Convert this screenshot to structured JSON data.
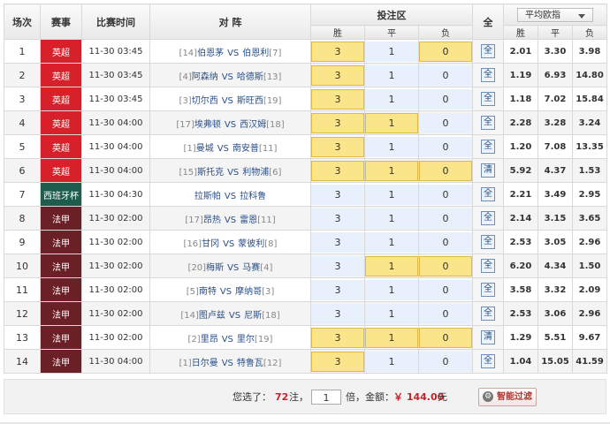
{
  "header": {
    "col_index": "场次",
    "col_league": "赛事",
    "col_time": "比赛时间",
    "col_match": "对 阵",
    "col_bet_zone": "投注区",
    "col_all": "全",
    "odds_dropdown": "平均欧指",
    "sub_win": "胜",
    "sub_draw": "平",
    "sub_loss": "负",
    "odds_win": "胜",
    "odds_draw": "平",
    "odds_loss": "负"
  },
  "colors": {
    "epl": "#d8202b",
    "laliga_cup": "#1e5c4d",
    "ligue1": "#6b1f27",
    "selected": "#fbe58a",
    "unselected": "#e8f1fb"
  },
  "rows": [
    {
      "idx": "1",
      "league": "英超",
      "league_type": "epl",
      "time": "11-30 03:45",
      "home_rank": "[14]",
      "home": "伯恩茅",
      "vs": "VS",
      "away": "伯恩利",
      "away_rank": "[7]",
      "bet_win": "3",
      "bet_draw": "1",
      "bet_loss": "0",
      "sel_win": true,
      "sel_draw": false,
      "sel_loss": true,
      "all_btn": "全",
      "odds_win": "2.01",
      "odds_draw": "3.30",
      "odds_loss": "3.98"
    },
    {
      "idx": "2",
      "league": "英超",
      "league_type": "epl",
      "time": "11-30 03:45",
      "home_rank": "[4]",
      "home": "阿森纳",
      "vs": "VS",
      "away": "哈德斯",
      "away_rank": "[13]",
      "bet_win": "3",
      "bet_draw": "1",
      "bet_loss": "0",
      "sel_win": true,
      "sel_draw": false,
      "sel_loss": false,
      "all_btn": "全",
      "odds_win": "1.19",
      "odds_draw": "6.93",
      "odds_loss": "14.80"
    },
    {
      "idx": "3",
      "league": "英超",
      "league_type": "epl",
      "time": "11-30 03:45",
      "home_rank": "[3]",
      "home": "切尔西",
      "vs": "VS",
      "away": "斯旺西",
      "away_rank": "[19]",
      "bet_win": "3",
      "bet_draw": "1",
      "bet_loss": "0",
      "sel_win": true,
      "sel_draw": false,
      "sel_loss": false,
      "all_btn": "全",
      "odds_win": "1.18",
      "odds_draw": "7.02",
      "odds_loss": "15.84"
    },
    {
      "idx": "4",
      "league": "英超",
      "league_type": "epl",
      "time": "11-30 04:00",
      "home_rank": "[17]",
      "home": "埃弗顿",
      "vs": "VS",
      "away": "西汉姆",
      "away_rank": "[18]",
      "bet_win": "3",
      "bet_draw": "1",
      "bet_loss": "0",
      "sel_win": true,
      "sel_draw": true,
      "sel_loss": false,
      "all_btn": "全",
      "odds_win": "2.28",
      "odds_draw": "3.28",
      "odds_loss": "3.24"
    },
    {
      "idx": "5",
      "league": "英超",
      "league_type": "epl",
      "time": "11-30 04:00",
      "home_rank": "[1]",
      "home": "曼城",
      "vs": "VS",
      "away": "南安普",
      "away_rank": "[11]",
      "bet_win": "3",
      "bet_draw": "1",
      "bet_loss": "0",
      "sel_win": true,
      "sel_draw": false,
      "sel_loss": false,
      "all_btn": "全",
      "odds_win": "1.20",
      "odds_draw": "7.08",
      "odds_loss": "13.35"
    },
    {
      "idx": "6",
      "league": "英超",
      "league_type": "epl",
      "time": "11-30 04:00",
      "home_rank": "[15]",
      "home": "斯托克",
      "vs": "VS",
      "away": "利物浦",
      "away_rank": "[6]",
      "bet_win": "3",
      "bet_draw": "1",
      "bet_loss": "0",
      "sel_win": true,
      "sel_draw": true,
      "sel_loss": true,
      "all_btn": "清",
      "odds_win": "5.92",
      "odds_draw": "4.37",
      "odds_loss": "1.53"
    },
    {
      "idx": "7",
      "league": "西班牙杯",
      "league_type": "laliga_cup",
      "time": "11-30 04:30",
      "home_rank": "",
      "home": "拉斯帕",
      "vs": "VS",
      "away": "拉科鲁",
      "away_rank": "",
      "bet_win": "3",
      "bet_draw": "1",
      "bet_loss": "0",
      "sel_win": false,
      "sel_draw": false,
      "sel_loss": false,
      "all_btn": "全",
      "odds_win": "2.21",
      "odds_draw": "3.49",
      "odds_loss": "2.95"
    },
    {
      "idx": "8",
      "league": "法甲",
      "league_type": "ligue1",
      "time": "11-30 02:00",
      "home_rank": "[17]",
      "home": "昂热",
      "vs": "VS",
      "away": "雷恩",
      "away_rank": "[11]",
      "bet_win": "3",
      "bet_draw": "1",
      "bet_loss": "0",
      "sel_win": false,
      "sel_draw": false,
      "sel_loss": false,
      "all_btn": "全",
      "odds_win": "2.14",
      "odds_draw": "3.15",
      "odds_loss": "3.65"
    },
    {
      "idx": "9",
      "league": "法甲",
      "league_type": "ligue1",
      "time": "11-30 02:00",
      "home_rank": "[16]",
      "home": "甘冈",
      "vs": "VS",
      "away": "蒙彼利",
      "away_rank": "[8]",
      "bet_win": "3",
      "bet_draw": "1",
      "bet_loss": "0",
      "sel_win": false,
      "sel_draw": false,
      "sel_loss": false,
      "all_btn": "全",
      "odds_win": "2.53",
      "odds_draw": "3.05",
      "odds_loss": "2.96"
    },
    {
      "idx": "10",
      "league": "法甲",
      "league_type": "ligue1",
      "time": "11-30 02:00",
      "home_rank": "[20]",
      "home": "梅斯",
      "vs": "VS",
      "away": "马赛",
      "away_rank": "[4]",
      "bet_win": "3",
      "bet_draw": "1",
      "bet_loss": "0",
      "sel_win": false,
      "sel_draw": true,
      "sel_loss": true,
      "all_btn": "全",
      "odds_win": "6.20",
      "odds_draw": "4.34",
      "odds_loss": "1.50"
    },
    {
      "idx": "11",
      "league": "法甲",
      "league_type": "ligue1",
      "time": "11-30 02:00",
      "home_rank": "[5]",
      "home": "南特",
      "vs": "VS",
      "away": "摩纳哥",
      "away_rank": "[3]",
      "bet_win": "3",
      "bet_draw": "1",
      "bet_loss": "0",
      "sel_win": false,
      "sel_draw": false,
      "sel_loss": false,
      "all_btn": "全",
      "odds_win": "3.58",
      "odds_draw": "3.32",
      "odds_loss": "2.09"
    },
    {
      "idx": "12",
      "league": "法甲",
      "league_type": "ligue1",
      "time": "11-30 02:00",
      "home_rank": "[14]",
      "home": "图卢兹",
      "vs": "VS",
      "away": "尼斯",
      "away_rank": "[18]",
      "bet_win": "3",
      "bet_draw": "1",
      "bet_loss": "0",
      "sel_win": false,
      "sel_draw": false,
      "sel_loss": false,
      "all_btn": "全",
      "odds_win": "2.53",
      "odds_draw": "3.06",
      "odds_loss": "2.96"
    },
    {
      "idx": "13",
      "league": "法甲",
      "league_type": "ligue1",
      "time": "11-30 02:00",
      "home_rank": "[2]",
      "home": "里昂",
      "vs": "VS",
      "away": "里尔",
      "away_rank": "[19]",
      "bet_win": "3",
      "bet_draw": "1",
      "bet_loss": "0",
      "sel_win": true,
      "sel_draw": true,
      "sel_loss": true,
      "all_btn": "清",
      "odds_win": "1.29",
      "odds_draw": "5.51",
      "odds_loss": "9.67"
    },
    {
      "idx": "14",
      "league": "法甲",
      "league_type": "ligue1",
      "time": "11-30 04:00",
      "home_rank": "[1]",
      "home": "日尔曼",
      "vs": "VS",
      "away": "特鲁瓦",
      "away_rank": "[12]",
      "bet_win": "3",
      "bet_draw": "1",
      "bet_loss": "0",
      "sel_win": true,
      "sel_draw": false,
      "sel_loss": false,
      "all_btn": "全",
      "odds_win": "1.04",
      "odds_draw": "15.05",
      "odds_loss": "41.59"
    }
  ],
  "footer": {
    "selected_prefix": "您选了：",
    "selected_count": "72",
    "bets_unit": "注，",
    "multiplier": "1",
    "amount_prefix": "倍，金额：",
    "amount": "￥ 144.00",
    "currency_unit": "元",
    "smart_filter": "智能过滤",
    "gear_glyph": "⚙"
  }
}
